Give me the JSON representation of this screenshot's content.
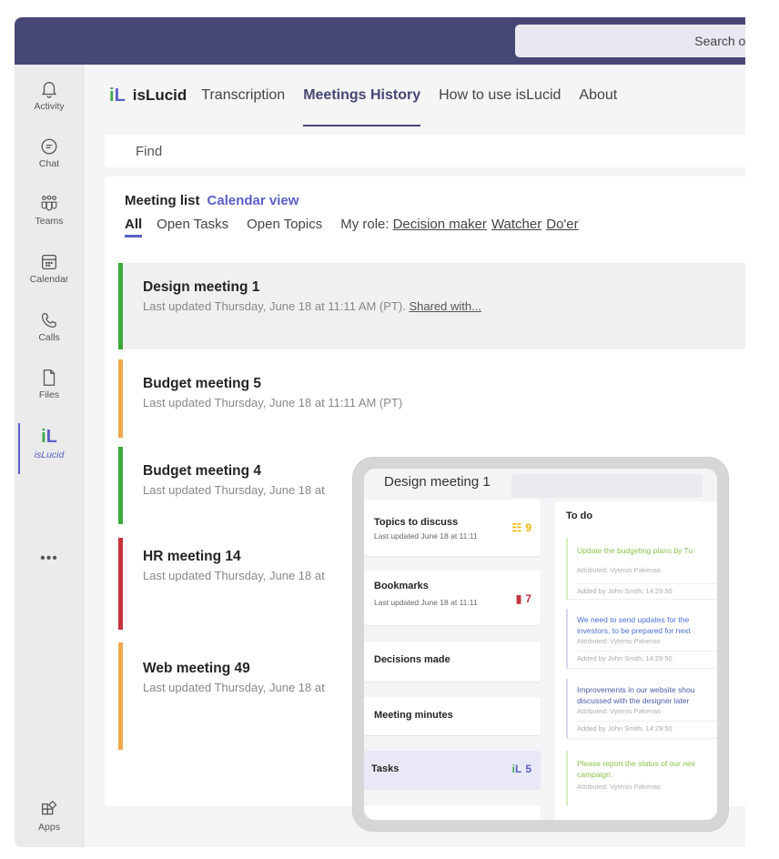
{
  "search": {
    "placeholder_visible": "Search or"
  },
  "rail": {
    "items": [
      {
        "label": "Activity",
        "icon": "bell-icon"
      },
      {
        "label": "Chat",
        "icon": "chat-icon"
      },
      {
        "label": "Teams",
        "icon": "teams-icon"
      },
      {
        "label": "Calendar",
        "icon": "calendar-icon"
      },
      {
        "label": "Calls",
        "icon": "phone-icon"
      },
      {
        "label": "Files",
        "icon": "file-icon"
      },
      {
        "label": "isLucid",
        "icon": "islucid-logo-icon"
      }
    ],
    "more": "•••",
    "apps": "Apps"
  },
  "nav": {
    "brand": "isLucid",
    "links": [
      "Transcription",
      "Meetings History",
      "How to use isLucid",
      "About"
    ],
    "active": "Meetings History"
  },
  "find": {
    "placeholder": "Find"
  },
  "panel": {
    "meeting_list": "Meeting list",
    "calendar_view": "Calendar view",
    "filters": {
      "all": "All",
      "open_tasks": "Open Tasks",
      "open_topics": "Open Topics",
      "my_role": "My role:",
      "roles": [
        "Decision maker",
        "Watcher",
        "Do'er"
      ]
    }
  },
  "meetings": [
    {
      "title": "Design meeting 1",
      "subtitle": "Last updated Thursday, June 18 at 11:11 AM (PT).",
      "shared": "Shared with...",
      "color": "#3aa83a"
    },
    {
      "title": "Budget meeting 5",
      "subtitle": "Last updated Thursday, June 18 at 11:11 AM (PT)",
      "color": "#f0a850"
    },
    {
      "title": "Budget meeting 4",
      "subtitle": "Last updated Thursday, June 18 at",
      "color": "#3aa83a"
    },
    {
      "title": "HR meeting 14",
      "subtitle": "Last updated Thursday, June 18 at",
      "color": "#c8323c"
    },
    {
      "title": "Web meeting 49",
      "subtitle": "Last updated Thursday, June 18 at",
      "color": "#f0a850"
    }
  ],
  "overlay": {
    "title": "Design meeting 1",
    "cards": [
      {
        "title": "Topics to discuss",
        "sub": "Last updated June 18 at 11:11",
        "count": "9",
        "icon": "list-icon",
        "color": "#f0b400"
      },
      {
        "title": "Bookmarks",
        "sub": "Last updated June 18 at 11:11",
        "count": "7",
        "icon": "bookmark-icon",
        "color": "#c8323c"
      },
      {
        "title": "Decisions made"
      },
      {
        "title": "Meeting minutes"
      },
      {
        "title": "Tasks",
        "count": "5",
        "icon": "islucid-logo-icon",
        "color": "#5b5fc7"
      }
    ],
    "todo": {
      "title": "To do",
      "tasks": [
        {
          "text": [
            "Update the budgeting plans by Tu"
          ],
          "attr": "Attributed: Vytenis Pakenas",
          "added": "Added by John Smith, 14:29:50",
          "color": "#8bc34a"
        },
        {
          "text": [
            "We need to send updates for the",
            "investors, to be prepared for next"
          ],
          "attr": "Attributed: Vytenis Pakenas",
          "added": "Added by John Smith, 14:29:50",
          "color": "#4a6fd8"
        },
        {
          "text": [
            "Improvements in our website shou",
            "discussed with the designer later"
          ],
          "attr": "Attributed: Vytenis Pakenas",
          "added": "Added by John Smith, 14:29:50",
          "color": "#4a5aa8"
        },
        {
          "text": [
            "Please report the status of our nev",
            "campaign."
          ],
          "attr": "Attributed: Vytenis Pakenas",
          "color": "#8bc34a"
        }
      ]
    }
  }
}
